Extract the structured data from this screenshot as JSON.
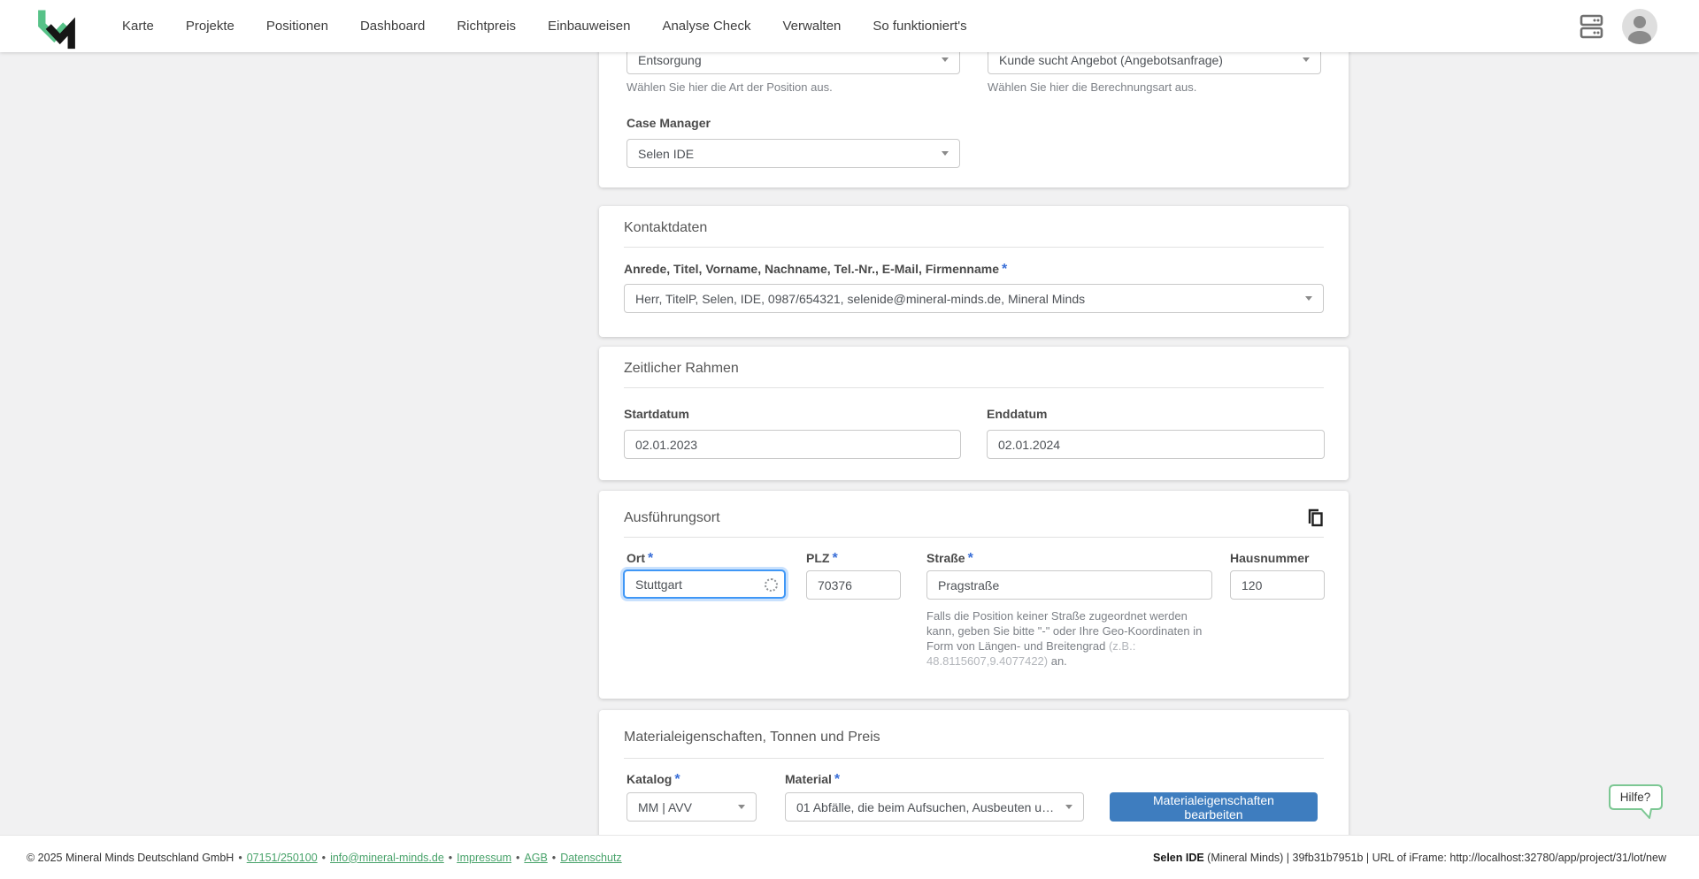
{
  "header": {
    "nav_items": [
      "Karte",
      "Projekte",
      "Positionen",
      "Dashboard",
      "Richtpreis",
      "Einbauweisen",
      "Analyse Check",
      "Verwalten",
      "So funktioniert's"
    ]
  },
  "form": {
    "position_art": {
      "art_value": "Entsorgung",
      "art_helper": "Wählen Sie hier die Art der Position aus.",
      "berechnungsart_value": "Kunde sucht Angebot (Angebotsanfrage)",
      "berechnungsart_helper": "Wählen Sie hier die Berechnungsart aus.",
      "case_manager_label": "Case Manager",
      "case_manager_value": "Selen IDE"
    },
    "required_mark": "*",
    "kontaktdaten": {
      "title": "Kontaktdaten",
      "label": "Anrede, Titel, Vorname, Nachname, Tel.-Nr., E-Mail, Firmenname",
      "value": "Herr, TitelP, Selen, IDE, 0987/654321, selenide@mineral-minds.de, Mineral Minds"
    },
    "zeitlicher_rahmen": {
      "title": "Zeitlicher Rahmen",
      "startdatum_label": "Startdatum",
      "startdatum_value": "02.01.2023",
      "enddatum_label": "Enddatum",
      "enddatum_value": "02.01.2024"
    },
    "ausfuehrungsort": {
      "title": "Ausführungsort",
      "ort_label": "Ort",
      "ort_value": "Stuttgart",
      "plz_label": "PLZ",
      "plz_value": "70376",
      "strasse_label": "Straße",
      "strasse_value": "Pragstraße",
      "hausnummer_label": "Hausnummer",
      "hausnummer_value": "120",
      "strasse_helper_part1": "Falls die Position keiner Straße zugeordnet werden kann, geben Sie bitte \"-\" oder Ihre Geo-Koordinaten in Form von Längen- und Breitengrad ",
      "strasse_helper_light": "(z.B.: 48.8115607,9.4077422)",
      "strasse_helper_part2": " an."
    },
    "material": {
      "title": "Materialeigenschaften, Tonnen und Preis",
      "katalog_label": "Katalog",
      "katalog_value": "MM | AVV",
      "material_label": "Material",
      "material_value": "01 Abfälle, die beim Aufsuchen, Ausbeuten und...",
      "edit_button_label": "Materialeigenschaften bearbeiten"
    }
  },
  "help_tooltip": "Hilfe?",
  "footer": {
    "copyright": "© 2025 Mineral Minds Deutschland GmbH",
    "separator": "•",
    "links": [
      "07151/250100",
      "info@mineral-minds.de",
      "Impressum",
      "AGB",
      "Datenschutz"
    ],
    "right_bold": "Selen IDE",
    "right_rest": " (Mineral Minds) | 39fb31b7951b | URL of iFrame: http://localhost:32780/app/project/31/lot/new"
  },
  "colors": {
    "button_blue": "#3e7dbf",
    "focus_blue": "#3f97f6",
    "required_blue": "#3a6fd8",
    "link_green": "#47a269",
    "logo_green": "#57c288",
    "bubble_green": "#7cc793",
    "page_background": "#f1f1f2"
  }
}
